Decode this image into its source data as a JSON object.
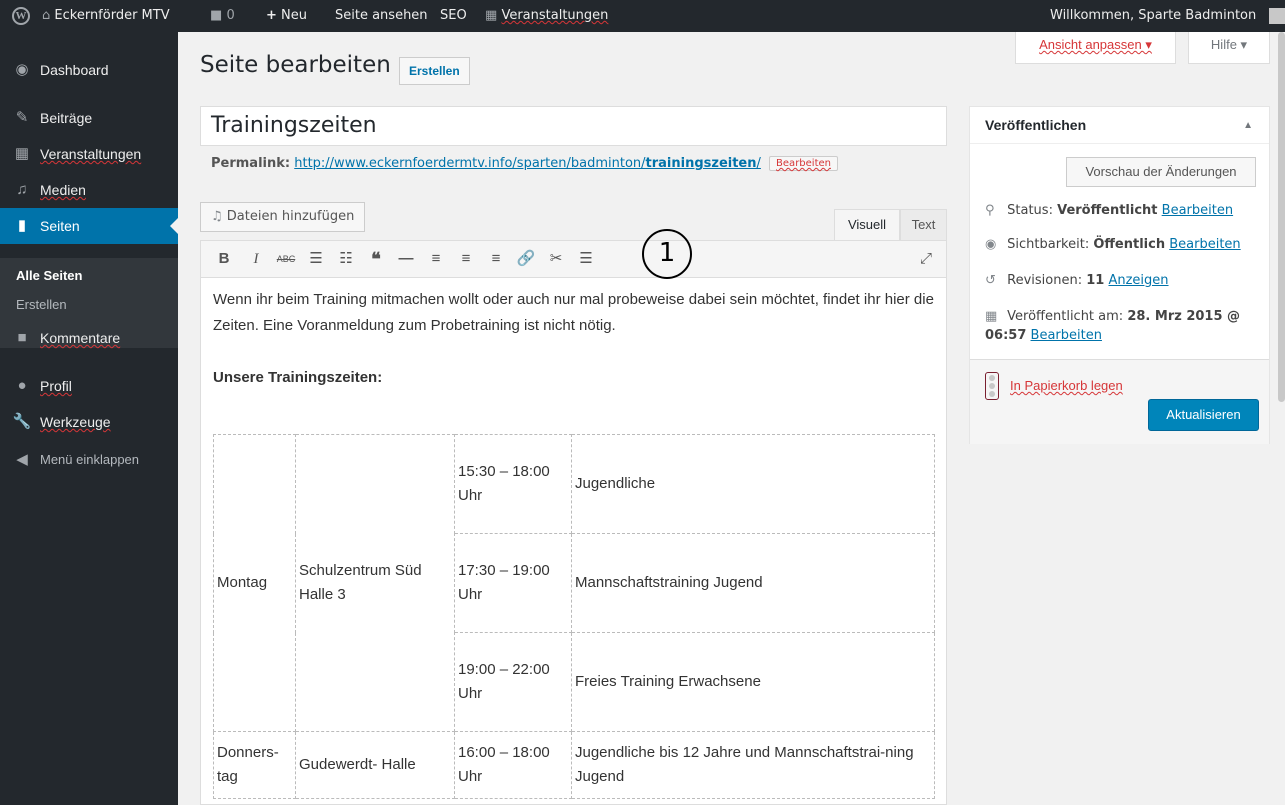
{
  "adminbar": {
    "site_name": "Eckernförder MTV",
    "comments_count": "0",
    "new_label": "Neu",
    "view_page": "Seite ansehen",
    "seo": "SEO",
    "events": "Veranstaltungen",
    "welcome": "Willkommen, Sparte Badminton"
  },
  "menu": {
    "dashboard": "Dashboard",
    "posts": "Beiträge",
    "events": "Veranstaltungen",
    "media": "Medien",
    "pages": "Seiten",
    "all_pages": "Alle Seiten",
    "create": "Erstellen",
    "comments": "Kommentare",
    "profile": "Profil",
    "tools": "Werkzeuge",
    "collapse": "Menü einklappen"
  },
  "screen_options": {
    "label": "Ansicht anpassen ▾",
    "help": "Hilfe ▾"
  },
  "header": {
    "title": "Seite bearbeiten",
    "add_new": "Erstellen"
  },
  "post": {
    "title": "Trainingszeiten",
    "permalink_label": "Permalink:",
    "permalink_base": "http://www.eckernfoerdermtv.info/sparten/badminton/",
    "permalink_slug": "trainingszeiten",
    "permalink_trail": "/",
    "permalink_edit": "Bearbeiten"
  },
  "editor": {
    "add_media": "Dateien hinzufügen",
    "tab_visual": "Visuell",
    "tab_text": "Text",
    "marker": "1",
    "intro": "Wenn ihr beim Training mitmachen wollt oder auch nur mal probeweise dabei sein möchtet, findet ihr hier die Zeiten. Eine Voranmeldung zum Probetraining ist nicht nötig.",
    "heading": "Unsere Trainingszeiten:",
    "schedule": {
      "monday": {
        "day": "Montag",
        "location": "Schulzentrum Süd Halle 3",
        "slots": [
          {
            "time": "15:30 – 18:00 Uhr",
            "group": "Jugendliche"
          },
          {
            "time": "17:30 – 19:00 Uhr",
            "group": "Mannschaftstraining Jugend"
          },
          {
            "time": "19:00 – 22:00 Uhr",
            "group": "Freies Training Erwachsene"
          }
        ]
      },
      "thursday": {
        "day": "Donners-tag",
        "location": "Gudewerdt- Halle",
        "slots": [
          {
            "time": "16:00 – 18:00 Uhr",
            "group": "Jugendliche bis 12 Jahre und Mannschaftstrai-ning Jugend"
          }
        ]
      }
    }
  },
  "publish": {
    "title": "Veröffentlichen",
    "preview": "Vorschau der Änderungen",
    "status_label": "Status:",
    "status_value": "Veröffentlicht",
    "visibility_label": "Sichtbarkeit:",
    "visibility_value": "Öffentlich",
    "revisions_label": "Revisionen:",
    "revisions_value": "11",
    "revisions_link": "Anzeigen",
    "published_label": "Veröffentlicht am:",
    "published_value": "28. Mrz 2015 @ 06:57",
    "edit": "Bearbeiten",
    "trash": "In Papierkorb legen",
    "update": "Aktualisieren"
  }
}
